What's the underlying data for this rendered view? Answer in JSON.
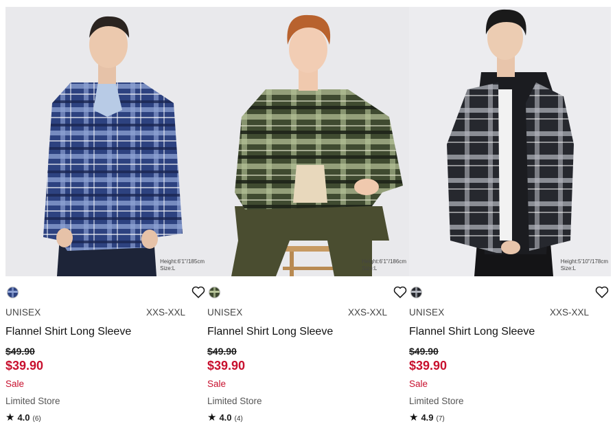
{
  "products": [
    {
      "model_height": "Height:6'1\"/185cm",
      "model_size": "Size:L",
      "gender": "UNISEX",
      "sizes": "XXS-XXL",
      "name": "Flannel Shirt Long Sleeve",
      "original_price": "$49.90",
      "sale_price": "$39.90",
      "sale_label": "Sale",
      "store": "Limited Store",
      "rating": "4.0",
      "review_count": "(6)",
      "swatch_color": "#3a4a7a",
      "shirt_color": "#2d4280",
      "shirt_accent": "#8fa3d4",
      "pants_color": "#1d2438",
      "icon_heart": "heart-outline-icon",
      "icon_star": "star-icon"
    },
    {
      "model_height": "Height:6'1\"/186cm",
      "model_size": "Size:L",
      "gender": "UNISEX",
      "sizes": "XXS-XXL",
      "name": "Flannel Shirt Long Sleeve",
      "original_price": "$49.90",
      "sale_price": "$39.90",
      "sale_label": "Sale",
      "store": "Limited Store",
      "rating": "4.0",
      "review_count": "(4)",
      "swatch_color": "#4e5a3c",
      "shirt_color": "#3f4a30",
      "shirt_accent": "#b8c49a",
      "pants_color": "#4a4d30",
      "icon_heart": "heart-outline-icon",
      "icon_star": "star-icon"
    },
    {
      "model_height": "Height:5'10\"/178cm",
      "model_size": "Size:L",
      "gender": "UNISEX",
      "sizes": "XXS-XXL",
      "name": "Flannel Shirt Long Sleeve",
      "original_price": "$49.90",
      "sale_price": "$39.90",
      "sale_label": "Sale",
      "store": "Limited Store",
      "rating": "4.9",
      "review_count": "(7)",
      "swatch_color": "#2b2e38",
      "shirt_color": "#26282e",
      "shirt_accent": "#b5b8c0",
      "pants_color": "#141416",
      "icon_heart": "heart-outline-icon",
      "icon_star": "star-icon"
    }
  ],
  "colors": {
    "sale_red": "#c8102e",
    "text_dark": "#111111",
    "text_muted": "#555555",
    "photo_bg": "#e8e8ea"
  }
}
